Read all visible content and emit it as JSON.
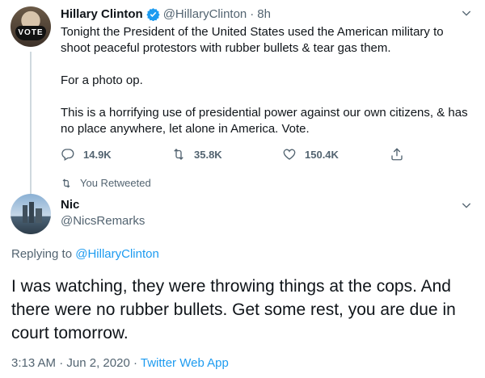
{
  "original_tweet": {
    "author_name": "Hillary Clinton",
    "author_handle": "@HillaryClinton",
    "separator": "·",
    "time_ago": "8h",
    "avatar_text": "VOTE",
    "paragraphs": [
      "Tonight the President of the United States used the American military to shoot peaceful protestors with rubber bullets & tear gas them.",
      "For a photo op.",
      "This is a horrifying use of presidential power against our own citizens, & has no place anywhere, let alone in America. Vote."
    ],
    "actions": {
      "reply_icon": "reply-icon",
      "replies": "14.9K",
      "retweet_icon": "retweet-icon",
      "retweets": "35.8K",
      "like_icon": "heart-icon",
      "likes": "150.4K",
      "share_icon": "share-icon"
    }
  },
  "retweeted_label": "You Retweeted",
  "reply_tweet": {
    "author_name": "Nic",
    "author_handle": "@NicsRemarks",
    "replying_prefix": "Replying to",
    "replying_to": "@HillaryClinton",
    "text": "I was watching, they were throwing things at the cops. And there were no rubber bullets. Get some rest, you are due in court tomorrow.",
    "time": "3:13 AM",
    "separator": "·",
    "date": "Jun 2, 2020",
    "source": "Twitter Web App"
  },
  "colors": {
    "accent": "#1d9bf0",
    "secondary_text": "#536471",
    "primary_text": "#0f1419"
  }
}
